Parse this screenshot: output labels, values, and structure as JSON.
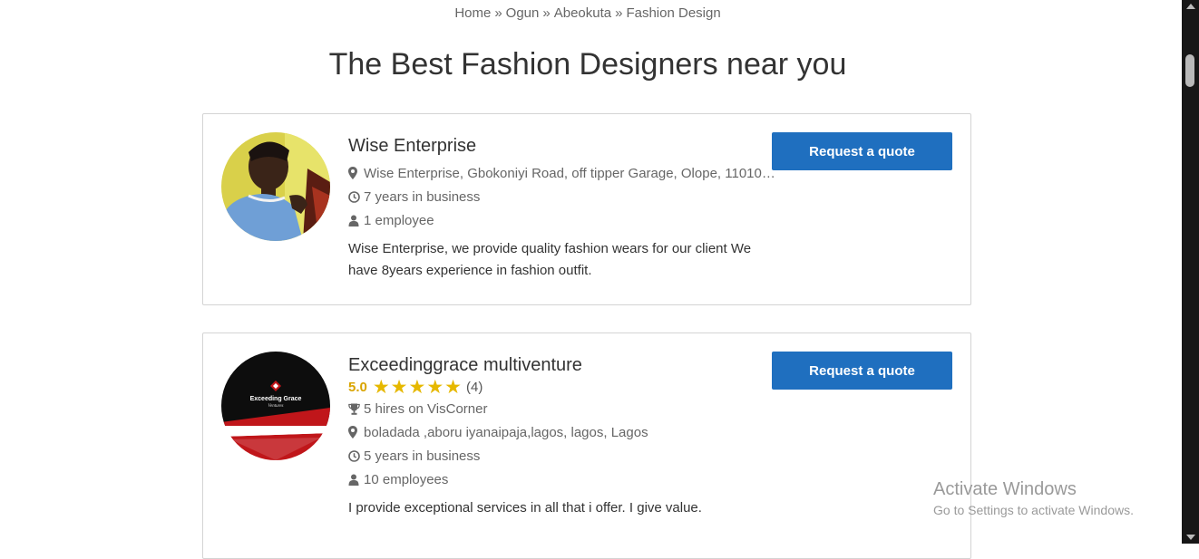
{
  "breadcrumb": {
    "items": [
      "Home",
      "Ogun",
      "Abeokuta",
      "Fashion Design"
    ],
    "separator": "»"
  },
  "page_title": "The Best Fashion Designers near you",
  "listings": [
    {
      "name": "Wise Enterprise",
      "address": "Wise Enterprise, Gbokoniyi Road, off tipper Garage, Olope, 11010…",
      "years": "7 years in business",
      "employees": "1 employee",
      "description": "Wise Enterprise, we provide quality fashion wears for our client We have 8years experience in fashion outfit.",
      "button_label": "Request a quote"
    },
    {
      "name": "Exceedinggrace multiventure",
      "rating_score": "5.0",
      "rating_stars": "★★★★★",
      "rating_count": "(4)",
      "hires": "5 hires on VisCorner",
      "address": "boladada ,aboru iyanaipaja,lagos, lagos, Lagos",
      "years": "5 years in business",
      "employees": "10 employees",
      "description": "I provide exceptional services in all that i offer. I give value.",
      "logo_text": "Exceeding Grace",
      "logo_subtext": "Ventures",
      "button_label": "Request a quote"
    }
  ],
  "watermark": {
    "line1": "Activate Windows",
    "line2": "Go to Settings to activate Windows."
  },
  "colors": {
    "button": "#1f6fbf",
    "star": "#e6b800",
    "score": "#d9a400"
  }
}
